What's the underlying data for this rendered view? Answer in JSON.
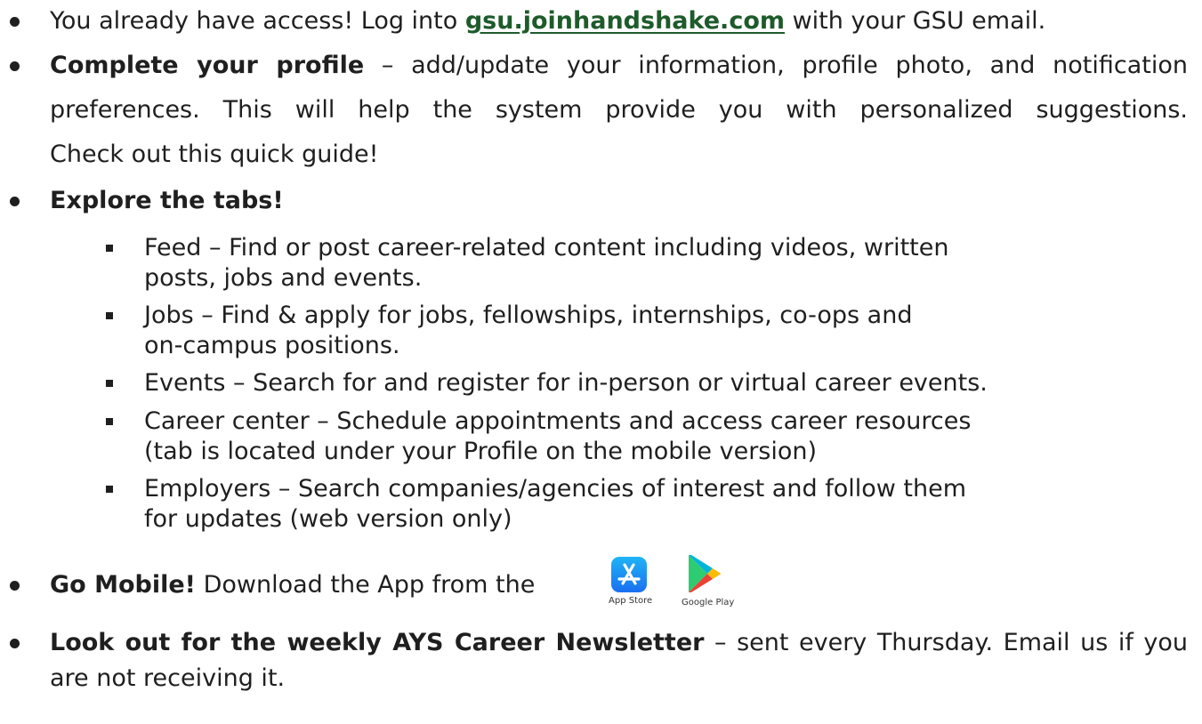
{
  "items": {
    "access": {
      "text_before": "You already have access! Log into ",
      "link_text": "gsu.joinhandshake.com",
      "text_after": " with your GSU email."
    },
    "profile": {
      "bold": "Complete your profile",
      "line1_rest": " – add/update your information, profile photo, and notification",
      "line2": "preferences. This will help the system provide you with personalized suggestions.",
      "line3": "Check out this quick guide!"
    },
    "tabs": {
      "bold": "Explore the tabs!",
      "subitems": [
        {
          "line1": "Feed – Find or post career-related content including videos, written",
          "line2": "posts, jobs and events."
        },
        {
          "line1": "Jobs – Find & apply for jobs, fellowships, internships, co-ops and",
          "line2": "on-campus positions."
        },
        {
          "line1": "Events – Search for and register for in-person or virtual career events.",
          "line2": ""
        },
        {
          "line1": "Career center – Schedule appointments and access career resources",
          "line2": "(tab is located under your Profile on the mobile version)"
        },
        {
          "line1": "Employers – Search companies/agencies of interest and follow them",
          "line2": "for updates (web version only)"
        }
      ]
    },
    "mobile": {
      "bold": "Go Mobile!",
      "rest": " Download the App from the",
      "app_store_caption": "App Store",
      "google_play_caption": "Google Play",
      "app_store_icon": "app-store-icon",
      "google_play_icon": "google-play-icon"
    },
    "newsletter": {
      "bold": "Look out for the weekly AYS Career Newsletter",
      "line1_rest": " – sent every Thursday. Email us if you",
      "line2": "are not receiving it."
    }
  },
  "colors": {
    "text": "#1f1f1f",
    "link": "#1e5b2b",
    "app_store_blue": "#1a8cf0"
  }
}
